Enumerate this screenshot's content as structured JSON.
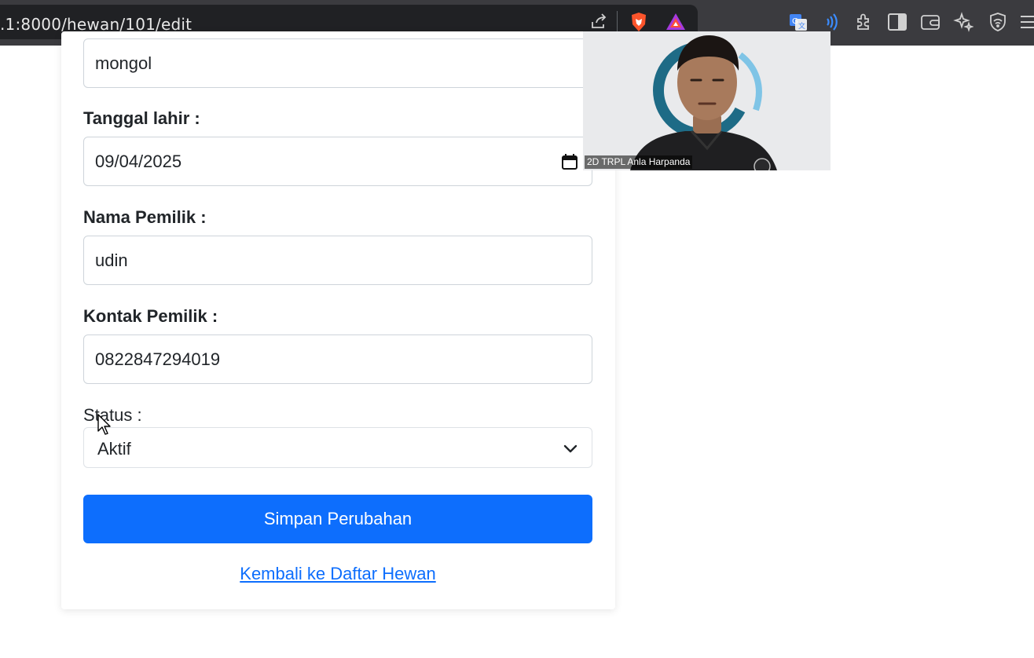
{
  "browser": {
    "url": ".1:8000/hewan/101/edit",
    "icons": [
      "share-icon",
      "brave-shield-icon",
      "brave-rewards-icon",
      "translate-icon",
      "speech-icon",
      "extensions-icon",
      "sidebar-icon",
      "wallet-icon",
      "leo-ai-icon",
      "vpn-icon",
      "menu-icon"
    ]
  },
  "form": {
    "jenis_value": "mongol",
    "tanggal_label": "Tanggal lahir :",
    "tanggal_value": "09/04/2025",
    "pemilik_label": "Nama Pemilik :",
    "pemilik_value": "udin",
    "kontak_label": "Kontak Pemilik :",
    "kontak_value": "0822847294019",
    "status_label": "Status :",
    "status_value": "Aktif",
    "submit_label": "Simpan Perubahan",
    "back_link": "Kembali ke Daftar Hewan"
  },
  "video": {
    "participant_name": "2D TRPL Anla Harpanda"
  },
  "colors": {
    "primary": "#0d6efd",
    "toolbar": "#3b3b3f",
    "urlbar": "#202124"
  }
}
